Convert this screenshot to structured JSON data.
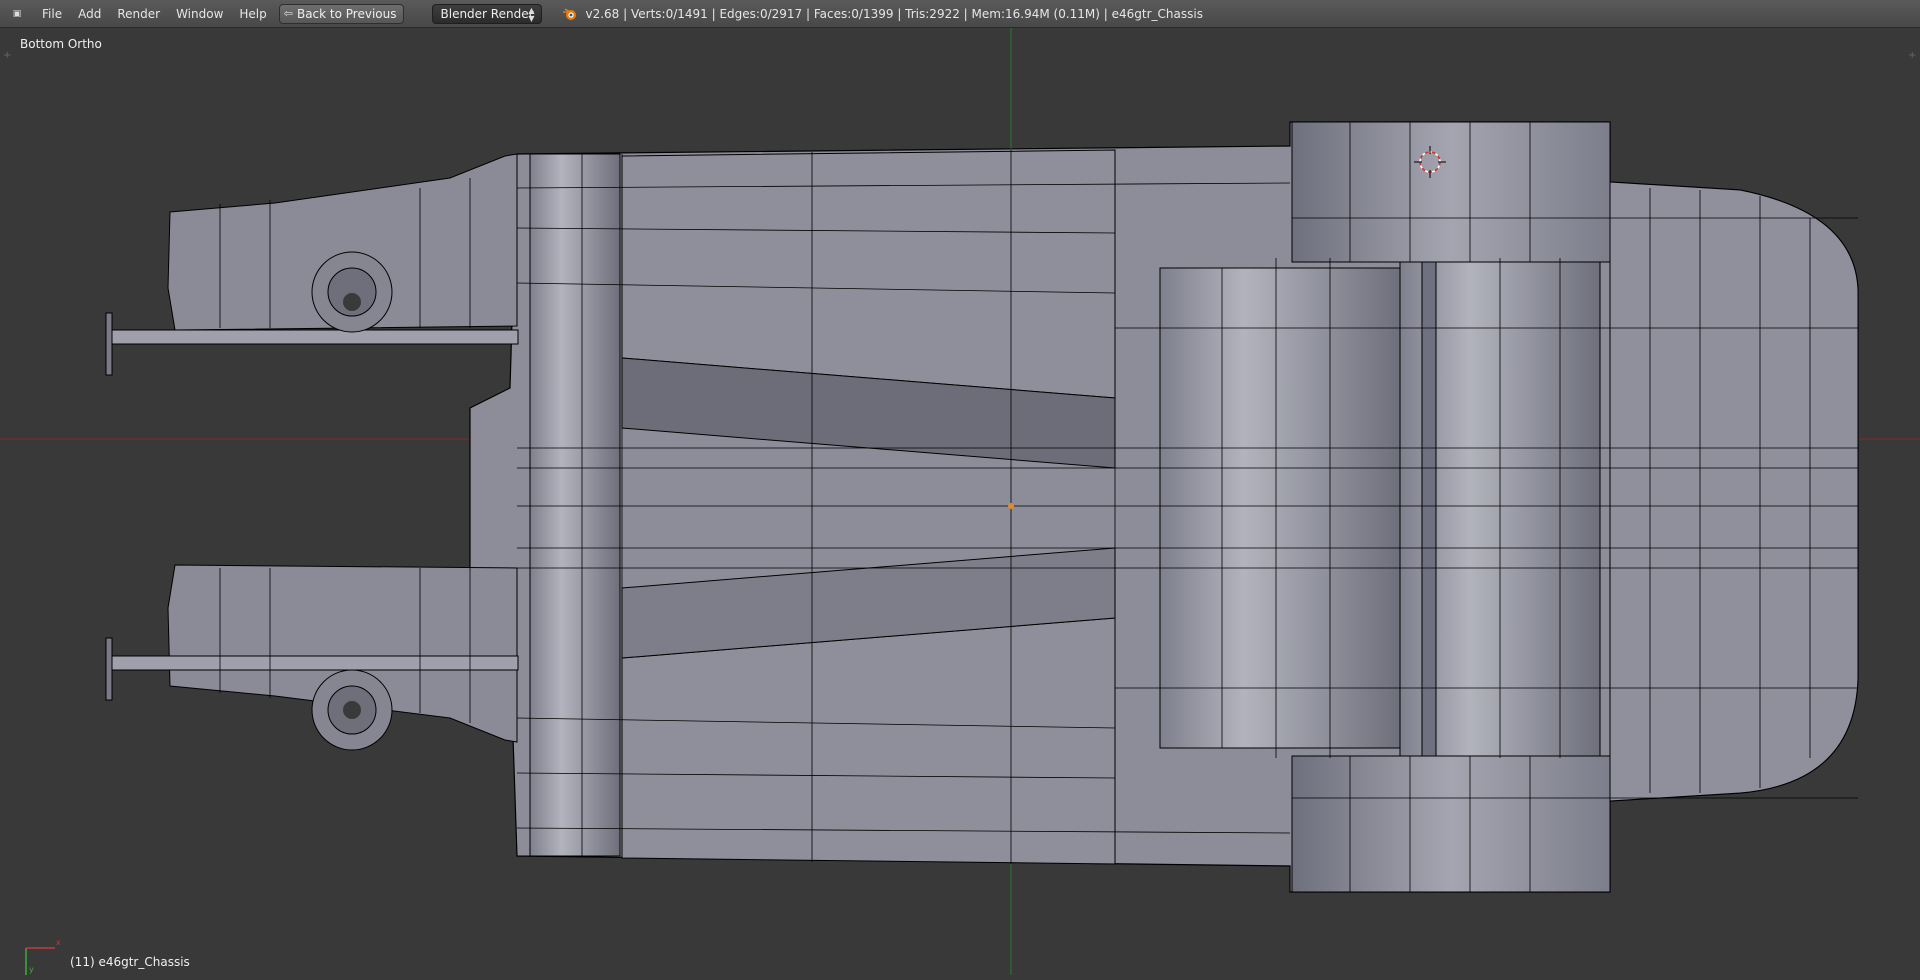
{
  "header": {
    "editor_type_icon": "view3d-icon",
    "menus": [
      "File",
      "Add",
      "Render",
      "Window",
      "Help"
    ],
    "back_button_label": "Back to Previous",
    "render_engine": "Blender Render",
    "stats": "v2.68 | Verts:0/1491 | Edges:0/2917 | Faces:0/1399 | Tris:2922 | Mem:16.94M (0.11M) | e46gtr_Chassis"
  },
  "viewport": {
    "view_name": "Bottom Ortho",
    "active_object": "(11) e46gtr_Chassis",
    "colors": {
      "background": "#393939",
      "x_axis": "#8a2a2a",
      "y_axis": "#2a8a2a",
      "mesh_fill": "#8c8d99",
      "wire": "#000000",
      "origin": "#e08a2a",
      "cursor": "#d03030"
    }
  }
}
